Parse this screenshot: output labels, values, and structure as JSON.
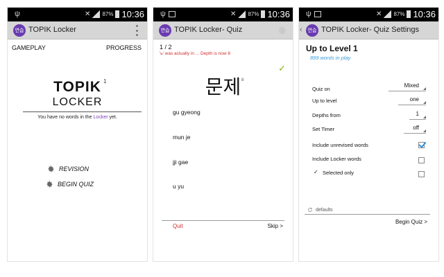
{
  "status_bar": {
    "time": "10:36",
    "battery": "87%"
  },
  "screens": {
    "home": {
      "app_title": "TOPIK Locker",
      "tab_gameplay": "GAMEPLAY",
      "tab_progress": "PROGRESS",
      "big_title": "TOPIK",
      "big_title_sup": "1",
      "subtitle": "LOCKER",
      "note_prefix": "You have no words in the ",
      "note_highlight": "Locker",
      "note_suffix": " yet.",
      "menu": [
        {
          "label": "REVISION",
          "icon": "gear-icon"
        },
        {
          "label": "BEGIN QUIZ",
          "icon": "gear-icon"
        }
      ]
    },
    "quiz": {
      "app_title": "TOPIK Locker- Quiz",
      "progress": "1 / 2",
      "message": "'ь' was actually in ... Depth is now 8",
      "check": "✓",
      "word": "문제",
      "word_sup": "8",
      "answers": [
        "gu gyeong",
        "mun je",
        "jji gae",
        "u yu"
      ],
      "quit_label": "Quit",
      "skip_label": "Skip  >"
    },
    "settings": {
      "app_title": "TOPIK Locker- Quiz Settings",
      "title": "Up to Level 1",
      "subtitle": "899 words in play",
      "quiz_on_label": "Quiz on",
      "quiz_on_value": "Mixed",
      "level_label": "Up to level",
      "level_value": "one",
      "depths_label": "Depths from",
      "depths_value": "1",
      "timer_label": "Set Timer",
      "timer_value": "off",
      "unrevised_label": "Include unrevised words",
      "unrevised_checked": true,
      "locker_label": "Include Locker words",
      "locker_checked": false,
      "selected_prefix": "✓",
      "selected_label": "Selected only",
      "selected_checked": false,
      "defaults_label": "defaults",
      "begin_label": "Begin Quiz  >"
    }
  },
  "app_icon_text": "연습",
  "colors": {
    "accent": "#6a3bb0",
    "error": "#d03030",
    "check": "#84b313",
    "info": "#3a9ad9"
  }
}
